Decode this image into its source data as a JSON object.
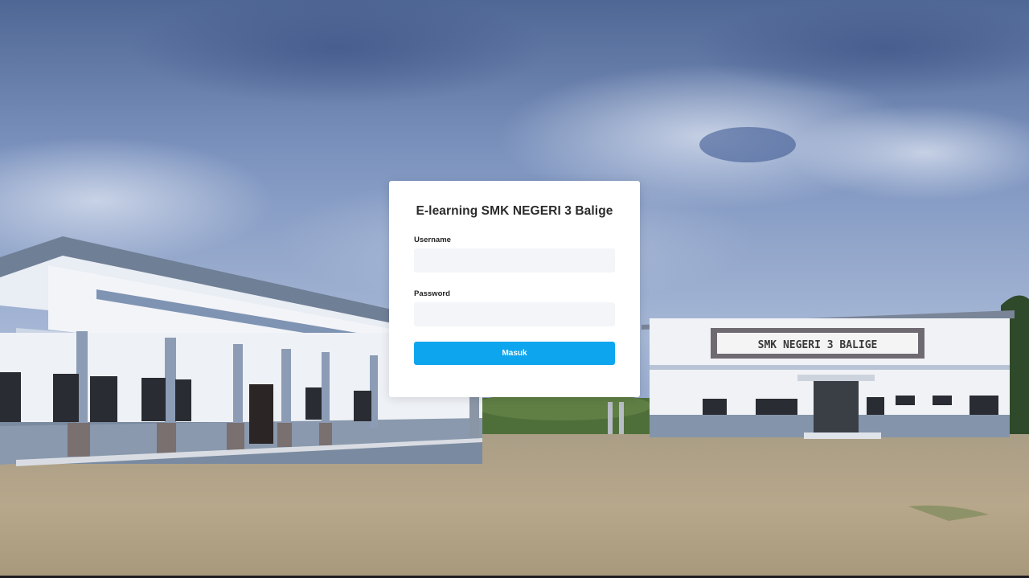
{
  "login": {
    "title": "E-learning SMK NEGERI 3 Balige",
    "username_label": "Username",
    "username_value": "",
    "password_label": "Password",
    "password_value": "",
    "submit_label": "Masuk"
  },
  "background": {
    "sign_text": "SMK NEGERI 3 BALIGE"
  },
  "colors": {
    "button": "#0ea5ef",
    "input_bg": "#f3f5f8",
    "card_bg": "#ffffff"
  }
}
